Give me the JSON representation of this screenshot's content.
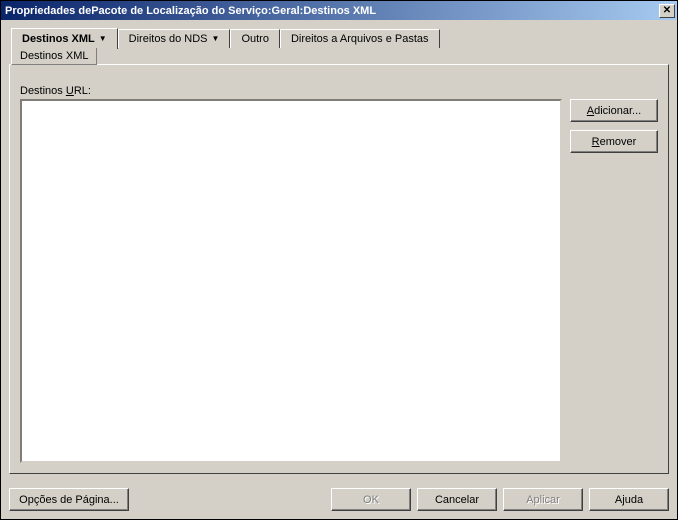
{
  "title": "Propriedades dePacote de Localização do Serviço:Geral:Destinos XML",
  "tabs": {
    "destinos_xml": "Destinos XML",
    "direitos_nds": "Direitos do NDS",
    "outro": "Outro",
    "direitos_arq": "Direitos a Arquivos e Pastas"
  },
  "subtabs": {
    "destinos_xml": "Destinos XML"
  },
  "panel": {
    "list_label_prefix": "Destinos ",
    "list_label_ul": "U",
    "list_label_suffix": "RL:"
  },
  "side_buttons": {
    "add_ul": "A",
    "add_rest": "dicionar...",
    "remove_ul": "R",
    "remove_rest": "emover"
  },
  "footer": {
    "page_options": "Opções de Página...",
    "ok": "OK",
    "cancel": "Cancelar",
    "apply": "Aplicar",
    "help": "Ajuda"
  }
}
